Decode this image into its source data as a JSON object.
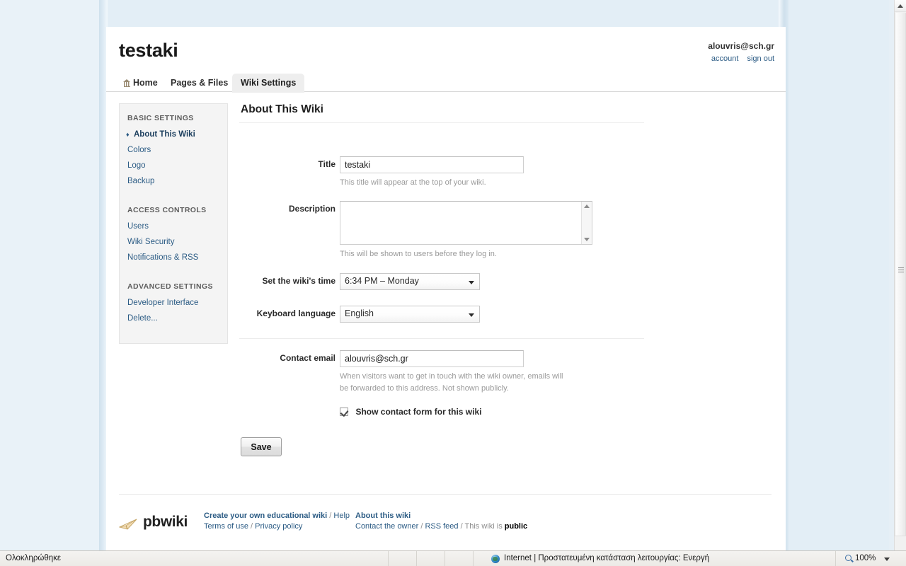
{
  "header": {
    "wiki_title": "testaki",
    "account_email": "alouvris@sch.gr",
    "account_link": "account",
    "signout_link": "sign out"
  },
  "tabs": [
    {
      "label": "Home",
      "icon": "home-icon",
      "active": false
    },
    {
      "label": "Pages & Files",
      "icon": "",
      "active": false
    },
    {
      "label": "Wiki Settings",
      "icon": "",
      "active": true
    }
  ],
  "sidebar": {
    "groups": [
      {
        "title": "BASIC SETTINGS",
        "items": [
          {
            "label": "About This Wiki",
            "current": true
          },
          {
            "label": "Colors",
            "current": false
          },
          {
            "label": "Logo",
            "current": false
          },
          {
            "label": "Backup",
            "current": false
          }
        ]
      },
      {
        "title": "ACCESS CONTROLS",
        "items": [
          {
            "label": "Users",
            "current": false
          },
          {
            "label": "Wiki Security",
            "current": false
          },
          {
            "label": "Notifications & RSS",
            "current": false
          }
        ]
      },
      {
        "title": "ADVANCED SETTINGS",
        "items": [
          {
            "label": "Developer Interface",
            "current": false
          },
          {
            "label": "Delete...",
            "current": false
          }
        ]
      }
    ]
  },
  "main": {
    "section_title": "About This Wiki",
    "title_field": {
      "label": "Title",
      "value": "testaki",
      "placeholder": "",
      "help": "This title will appear at the top of your wiki."
    },
    "description_field": {
      "label": "Description",
      "value": "",
      "placeholder": "",
      "help": "This will be shown to users before they log in."
    },
    "time_field": {
      "label": "Set the wiki's time",
      "value": "6:34 PM – Monday"
    },
    "language_field": {
      "label": "Keyboard language",
      "value": "English"
    },
    "email_field": {
      "label": "Contact email",
      "value": "alouvris@sch.gr",
      "placeholder": "",
      "help": "When visitors want to get in touch with the wiki owner, emails will be forwarded to this address. Not shown publicly."
    },
    "contact_form_checkbox": {
      "label": "Show contact form for this wiki",
      "checked": true
    },
    "save_button": "Save"
  },
  "footer": {
    "logo_text": "pbwiki",
    "col1": {
      "create_link": "Create your own educational wiki",
      "sep1": " / ",
      "help_link": "Help",
      "terms_link": "Terms of use",
      "sep2": " / ",
      "privacy_link": "Privacy policy"
    },
    "col2": {
      "about_link": "About this wiki",
      "contact_link": "Contact the owner",
      "sep1": " / ",
      "rss_link": "RSS feed",
      "sep2": " / ",
      "public_prefix": "This wiki is ",
      "public_value": "public"
    }
  },
  "statusbar": {
    "status_text": "Ολοκληρώθηκε",
    "zone_text": "Internet | Προστατευμένη κατάσταση λειτουργίας: Ενεργή",
    "zoom_level": "100%"
  },
  "colors": {
    "link": "#2b5b84",
    "page_bg": "#ffffff",
    "outer_bg": "#e3eef6",
    "sidebar_bg": "#f4f4f4"
  }
}
